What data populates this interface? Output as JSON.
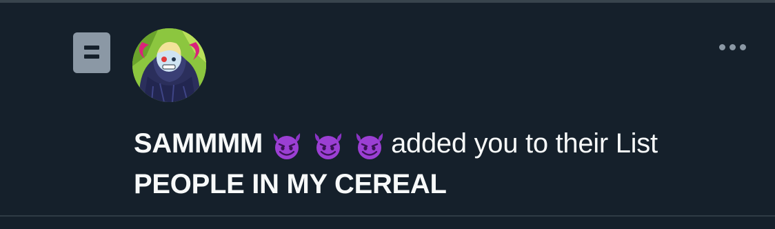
{
  "notification": {
    "user_name": "SAMMMM",
    "emoji_names": [
      "smiling-imp-emoji",
      "smiling-imp-emoji",
      "smiling-imp-emoji"
    ],
    "action_text": "added you to their List",
    "list_name": "PEOPLE IN MY CEREAL"
  },
  "icons": {
    "list_icon": "list-icon",
    "more_icon": "more-horizontal-icon"
  },
  "colors": {
    "background": "#15202b",
    "divider": "#38444d",
    "icon_gray": "#8b98a5",
    "text": "#f7f9f9",
    "emoji_purple": "#9b3fd3"
  }
}
